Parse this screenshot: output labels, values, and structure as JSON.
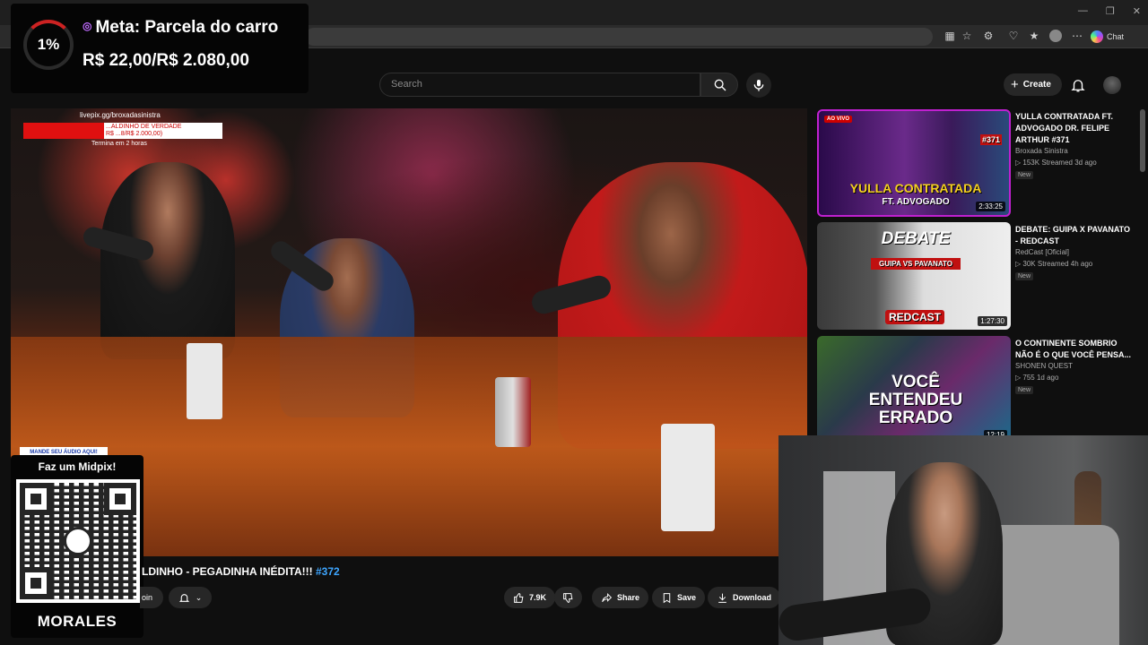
{
  "browser": {
    "chat_label": "Chat",
    "window_controls": [
      "—",
      "❐",
      "✕"
    ]
  },
  "goal": {
    "percent": "1%",
    "progress": 0.01,
    "title": "Meta: Parcela do carro",
    "amount": "R$ 22,00/R$ 2.080,00"
  },
  "youtube": {
    "search_placeholder": "Search",
    "create_label": "Create"
  },
  "stream": {
    "url": "livepix.gg/broxadasinistra",
    "banner_text": "...ALDINHO DE VERDADE",
    "banner_amount": "R$ ...8/R$ 2.000,00)",
    "timer": "Termina em 2 horas",
    "audio_tag": "MANDE SEU ÁUDIO AQUI!"
  },
  "qr": {
    "title": "Faz um Midpix!",
    "name": "MORALES"
  },
  "video": {
    "title": "LDINHO - PEGADINHA INÉDITA!!!",
    "tag": "#372",
    "join_label": "oin",
    "likes": "7.9K",
    "share_label": "Share",
    "save_label": "Save",
    "download_label": "Download"
  },
  "recommendations": [
    {
      "title": "YULLA CONTRATADA FT. ADVOGADO DR. FELIPE ARTHUR #371",
      "channel": "Broxada Sinistra",
      "views": "153K",
      "age": "Streamed 3d ago",
      "badge": "New",
      "duration": "2:33:25",
      "thumb_text": "YULLA CONTRATADA",
      "thumb_sub": "FT. ADVOGADO",
      "thumb_live": "AO VIVO",
      "thumb_num": "#371"
    },
    {
      "title": "DEBATE: GUIPA X PAVANATO - REDCAST",
      "channel": "RedCast [Oficial]",
      "views": "30K",
      "age": "Streamed 4h ago",
      "badge": "New",
      "duration": "1:27:30",
      "thumb_text": "DEBATE",
      "thumb_sub": "GUIPA VS PAVANATO",
      "thumb_brand": "REDCAST"
    },
    {
      "title": "O CONTINENTE SOMBRIO NÃO É O QUE VOCÊ PENSA...",
      "channel": "SHONEN QUEST",
      "views": "755",
      "age": "1d ago",
      "badge": "New",
      "duration": "12:19",
      "thumb_text": "VOCÊ ENTENDEU ERRADO"
    }
  ],
  "colors": {
    "accent_red": "#cc0000",
    "link_blue": "#3ea6ff",
    "goal_ring": "#cc2222"
  }
}
